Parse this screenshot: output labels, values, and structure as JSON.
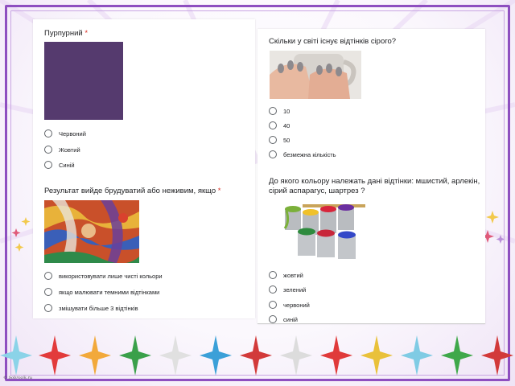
{
  "colors": {
    "frame": "#8e4fc0",
    "purple_swatch": "#553a6e",
    "required": "#d93025"
  },
  "left_card": {
    "q1": {
      "title": "Пурпурний",
      "required_mark": "*",
      "options": [
        "Червоний",
        "Жовтий",
        "Синій"
      ]
    },
    "q2": {
      "title": "Результат вийде брудуватий або неживим, якщо",
      "required_mark": "*",
      "options": [
        "використовувати лише чисті кольори",
        "якщо малювати темними відтінками",
        "змішувати більше 3 відтінків"
      ]
    }
  },
  "right_card": {
    "q3": {
      "title": "Скільки у світі існує відтінків сірого?",
      "options": [
        "10",
        "40",
        "50",
        "безмежна кількість"
      ]
    },
    "q4": {
      "title_line1": "До якого кольору належать дані відтінки: мшистий, арлекін,",
      "title_line2": "сірий аспарагус, шартрез ?",
      "options": [
        "жовтий",
        "зелений",
        "червоний",
        "синій"
      ]
    }
  },
  "watermark": "© Sobrozik.ru"
}
